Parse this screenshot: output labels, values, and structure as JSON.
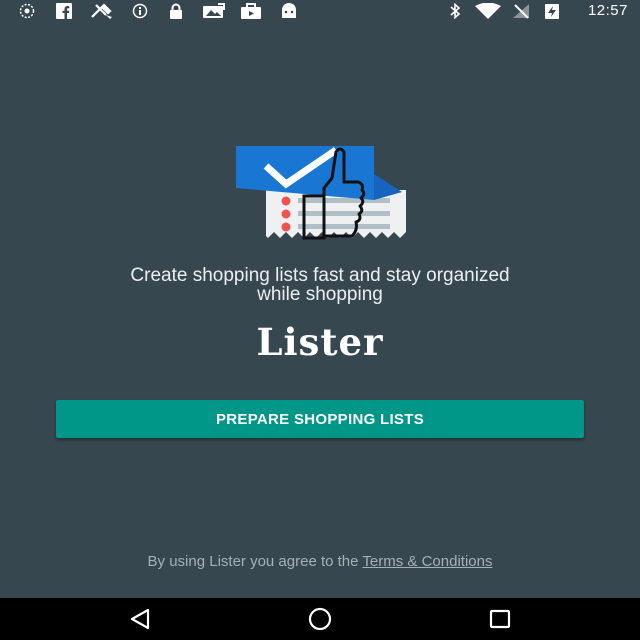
{
  "status_bar": {
    "time": "12:57",
    "left_icons": [
      "sync-icon",
      "facebook-icon",
      "tools-icon",
      "info-icon",
      "lock-icon",
      "photo-icon",
      "briefcase-icon",
      "android-icon"
    ],
    "right_icons": [
      "bluetooth-icon",
      "wifi-icon",
      "no-signal-icon",
      "battery-charging-icon"
    ]
  },
  "main": {
    "tagline_line1": "Create shopping lists fast and stay organized",
    "tagline_line2": "while shopping",
    "app_title": "Lister",
    "primary_button": "PREPARE SHOPPING LISTS",
    "terms_prefix": "By using Lister you agree to the",
    "terms_link": "Terms & Conditions"
  },
  "colors": {
    "background": "#37474f",
    "button": "#009688",
    "logo_blue": "#1976d2",
    "nav_bar": "#000000"
  },
  "nav_bar": {
    "back": "back-icon",
    "home": "home-icon",
    "recents": "recents-icon"
  }
}
